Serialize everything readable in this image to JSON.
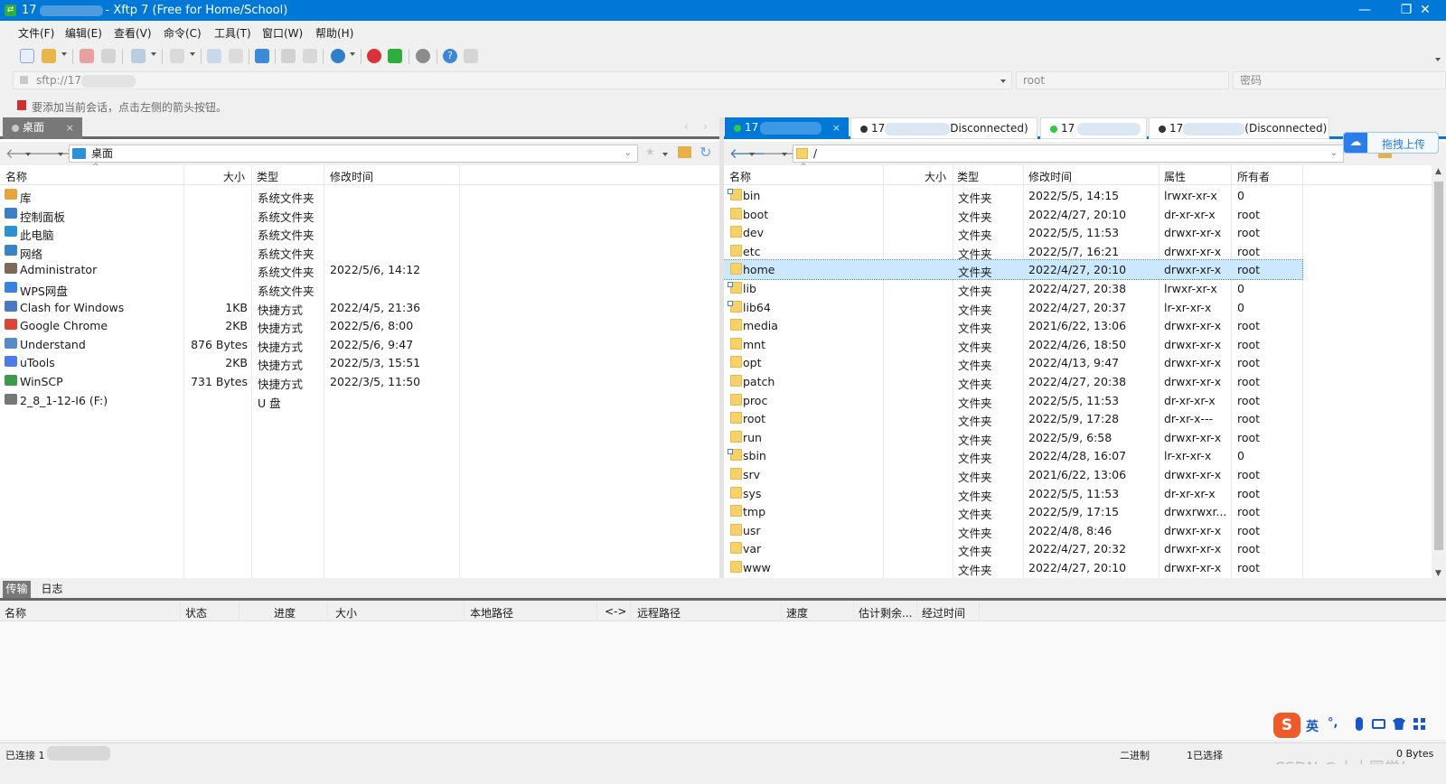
{
  "title": {
    "prefix": "17",
    "text": "- Xftp 7 (Free for Home/School)"
  },
  "menu": [
    "文件(F)",
    "编辑(E)",
    "查看(V)",
    "命令(C)",
    "工具(T)",
    "窗口(W)",
    "帮助(H)"
  ],
  "address": {
    "host_prefix": "sftp://17",
    "user": "root",
    "password_placeholder": "密码"
  },
  "hint": "要添加当前会话，点击左侧的箭头按钮。",
  "local": {
    "tab": "桌面",
    "path": "桌面",
    "headers": [
      "名称",
      "大小",
      "类型",
      "修改时间"
    ],
    "rows": [
      {
        "name": "库",
        "size": "",
        "type": "系统文件夹",
        "modified": "",
        "icon": "library-icon",
        "color": "#e8a33b"
      },
      {
        "name": "控制面板",
        "size": "",
        "type": "系统文件夹",
        "modified": "",
        "icon": "control-panel-icon",
        "color": "#3c7fc7"
      },
      {
        "name": "此电脑",
        "size": "",
        "type": "系统文件夹",
        "modified": "",
        "icon": "computer-icon",
        "color": "#2d8fd6"
      },
      {
        "name": "网络",
        "size": "",
        "type": "系统文件夹",
        "modified": "",
        "icon": "network-icon",
        "color": "#3a83c9"
      },
      {
        "name": "Administrator",
        "size": "",
        "type": "系统文件夹",
        "modified": "2022/5/6, 14:12",
        "icon": "user-folder-icon",
        "color": "#7a6a55"
      },
      {
        "name": "WPS网盘",
        "size": "",
        "type": "系统文件夹",
        "modified": "",
        "icon": "cloud-icon",
        "color": "#3b82e0"
      },
      {
        "name": "Clash for Windows",
        "size": "1KB",
        "type": "快捷方式",
        "modified": "2022/4/5, 21:36",
        "icon": "clash-icon",
        "color": "#4a78c2"
      },
      {
        "name": "Google Chrome",
        "size": "2KB",
        "type": "快捷方式",
        "modified": "2022/5/6, 8:00",
        "icon": "chrome-icon",
        "color": "#db4437"
      },
      {
        "name": "Understand",
        "size": "876 Bytes",
        "type": "快捷方式",
        "modified": "2022/5/6, 9:47",
        "icon": "understand-icon",
        "color": "#5a8cc4"
      },
      {
        "name": "uTools",
        "size": "2KB",
        "type": "快捷方式",
        "modified": "2022/5/3, 15:51",
        "icon": "utools-icon",
        "color": "#4d7be8"
      },
      {
        "name": "WinSCP",
        "size": "731 Bytes",
        "type": "快捷方式",
        "modified": "2022/3/5, 11:50",
        "icon": "winscp-icon",
        "color": "#3c9a4a"
      },
      {
        "name": "2_8_1-12-I6 (F:)",
        "size": "",
        "type": "U 盘",
        "modified": "",
        "icon": "usb-drive-icon",
        "color": "#777777"
      }
    ]
  },
  "remote": {
    "tabs": [
      {
        "label": "17",
        "status": "",
        "active": true
      },
      {
        "label": "17",
        "status": "Disconnected)",
        "active": false
      },
      {
        "label": "17",
        "status": "",
        "active": false
      },
      {
        "label": "17",
        "status": "(Disconnected)",
        "active": false
      }
    ],
    "path": "/",
    "headers": [
      "名称",
      "大小",
      "类型",
      "修改时间",
      "属性",
      "所有者"
    ],
    "rows": [
      {
        "name": "bin",
        "type": "文件夹",
        "modified": "2022/5/5, 14:15",
        "attr": "lrwxr-xr-x",
        "owner": "0",
        "link": true
      },
      {
        "name": "boot",
        "type": "文件夹",
        "modified": "2022/4/27, 20:10",
        "attr": "dr-xr-xr-x",
        "owner": "root",
        "link": false
      },
      {
        "name": "dev",
        "type": "文件夹",
        "modified": "2022/5/5, 11:53",
        "attr": "drwxr-xr-x",
        "owner": "root",
        "link": false
      },
      {
        "name": "etc",
        "type": "文件夹",
        "modified": "2022/5/7, 16:21",
        "attr": "drwxr-xr-x",
        "owner": "root",
        "link": false
      },
      {
        "name": "home",
        "type": "文件夹",
        "modified": "2022/4/27, 20:10",
        "attr": "drwxr-xr-x",
        "owner": "root",
        "link": false,
        "selected": true
      },
      {
        "name": "lib",
        "type": "文件夹",
        "modified": "2022/4/27, 20:38",
        "attr": "lrwxr-xr-x",
        "owner": "0",
        "link": true
      },
      {
        "name": "lib64",
        "type": "文件夹",
        "modified": "2022/4/27, 20:37",
        "attr": "lr-xr-xr-x",
        "owner": "0",
        "link": true
      },
      {
        "name": "media",
        "type": "文件夹",
        "modified": "2021/6/22, 13:06",
        "attr": "drwxr-xr-x",
        "owner": "root",
        "link": false
      },
      {
        "name": "mnt",
        "type": "文件夹",
        "modified": "2022/4/26, 18:50",
        "attr": "drwxr-xr-x",
        "owner": "root",
        "link": false
      },
      {
        "name": "opt",
        "type": "文件夹",
        "modified": "2022/4/13, 9:47",
        "attr": "drwxr-xr-x",
        "owner": "root",
        "link": false
      },
      {
        "name": "patch",
        "type": "文件夹",
        "modified": "2022/4/27, 20:38",
        "attr": "drwxr-xr-x",
        "owner": "root",
        "link": false
      },
      {
        "name": "proc",
        "type": "文件夹",
        "modified": "2022/5/5, 11:53",
        "attr": "dr-xr-xr-x",
        "owner": "root",
        "link": false
      },
      {
        "name": "root",
        "type": "文件夹",
        "modified": "2022/5/9, 17:28",
        "attr": "dr-xr-x---",
        "owner": "root",
        "link": false
      },
      {
        "name": "run",
        "type": "文件夹",
        "modified": "2022/5/9, 6:58",
        "attr": "drwxr-xr-x",
        "owner": "root",
        "link": false
      },
      {
        "name": "sbin",
        "type": "文件夹",
        "modified": "2022/4/28, 16:07",
        "attr": "lr-xr-xr-x",
        "owner": "0",
        "link": true
      },
      {
        "name": "srv",
        "type": "文件夹",
        "modified": "2021/6/22, 13:06",
        "attr": "drwxr-xr-x",
        "owner": "root",
        "link": false
      },
      {
        "name": "sys",
        "type": "文件夹",
        "modified": "2022/5/5, 11:53",
        "attr": "dr-xr-xr-x",
        "owner": "root",
        "link": false
      },
      {
        "name": "tmp",
        "type": "文件夹",
        "modified": "2022/5/9, 17:15",
        "attr": "drwxrwxr...",
        "owner": "root",
        "link": false
      },
      {
        "name": "usr",
        "type": "文件夹",
        "modified": "2022/4/8, 8:46",
        "attr": "drwxr-xr-x",
        "owner": "root",
        "link": false
      },
      {
        "name": "var",
        "type": "文件夹",
        "modified": "2022/4/27, 20:32",
        "attr": "drwxr-xr-x",
        "owner": "root",
        "link": false
      },
      {
        "name": "www",
        "type": "文件夹",
        "modified": "2022/4/27, 20:10",
        "attr": "drwxr-xr-x",
        "owner": "root",
        "link": false
      }
    ]
  },
  "upload_button": "拖拽上传",
  "bottom_tabs": [
    "传输",
    "日志"
  ],
  "transfer_headers": [
    "名称",
    "状态",
    "进度",
    "大小",
    "本地路径",
    "<->",
    "远程路径",
    "速度",
    "估计剩余...",
    "经过时间"
  ],
  "ime": {
    "mode": "英",
    "punct": "°,"
  },
  "status": {
    "connected": "已连接 1",
    "mode": "二进制",
    "selected": "1已选择",
    "size": "0 Bytes"
  },
  "watermark": "CSDN @小土同学！",
  "colors": {
    "accent": "#0078d7",
    "selection": "#cce8ff",
    "folder": "#f7d26a"
  }
}
